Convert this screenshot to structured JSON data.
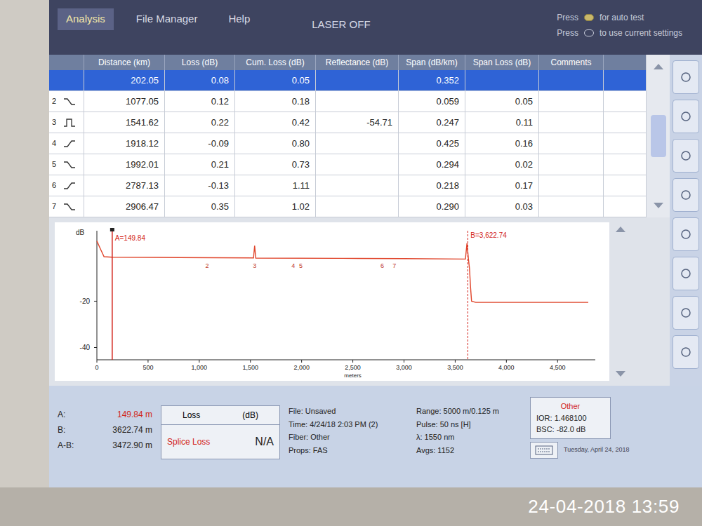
{
  "menu": [
    {
      "label": "Analysis",
      "selected": true
    },
    {
      "label": "File Manager",
      "selected": false
    },
    {
      "label": "Help",
      "selected": false
    }
  ],
  "laser_status": "LASER OFF",
  "press_hints": [
    {
      "before": "Press",
      "after": "for auto test"
    },
    {
      "before": "Press",
      "after": "to use current settings"
    }
  ],
  "table": {
    "columns": [
      "Distance (km)",
      "Loss (dB)",
      "Cum. Loss (dB)",
      "Reflectance (dB)",
      "Span (dB/km)",
      "Span Loss (dB)",
      "Comments"
    ],
    "rows": [
      {
        "index": "",
        "kind": "none",
        "distance": "202.05",
        "loss": "0.08",
        "cum_loss": "0.05",
        "reflectance": "",
        "span": "0.352",
        "span_loss": "",
        "comments": "",
        "selected": true
      },
      {
        "index": "2",
        "kind": "drop",
        "distance": "1077.05",
        "loss": "0.12",
        "cum_loss": "0.18",
        "reflectance": "",
        "span": "0.059",
        "span_loss": "0.05",
        "comments": "",
        "selected": false
      },
      {
        "index": "3",
        "kind": "reflect",
        "distance": "1541.62",
        "loss": "0.22",
        "cum_loss": "0.42",
        "reflectance": "-54.71",
        "span": "0.247",
        "span_loss": "0.11",
        "comments": "",
        "selected": false
      },
      {
        "index": "4",
        "kind": "gain",
        "distance": "1918.12",
        "loss": "-0.09",
        "cum_loss": "0.80",
        "reflectance": "",
        "span": "0.425",
        "span_loss": "0.16",
        "comments": "",
        "selected": false
      },
      {
        "index": "5",
        "kind": "drop",
        "distance": "1992.01",
        "loss": "0.21",
        "cum_loss": "0.73",
        "reflectance": "",
        "span": "0.294",
        "span_loss": "0.02",
        "comments": "",
        "selected": false
      },
      {
        "index": "6",
        "kind": "gain",
        "distance": "2787.13",
        "loss": "-0.13",
        "cum_loss": "1.11",
        "reflectance": "",
        "span": "0.218",
        "span_loss": "0.17",
        "comments": "",
        "selected": false
      },
      {
        "index": "7",
        "kind": "drop",
        "distance": "2906.47",
        "loss": "0.35",
        "cum_loss": "1.02",
        "reflectance": "",
        "span": "0.290",
        "span_loss": "0.03",
        "comments": "",
        "selected": false
      }
    ]
  },
  "chart": {
    "y_label": "dB",
    "y_ticks": [
      {
        "label": "-20",
        "value": -20
      },
      {
        "label": "-40",
        "value": -40
      }
    ],
    "x_ticks": [
      {
        "label": "0",
        "value": 0
      },
      {
        "label": "500",
        "value": 500
      },
      {
        "label": "1,000",
        "value": 1000
      },
      {
        "label": "1,500",
        "value": 1500
      },
      {
        "label": "2,000",
        "value": 2000
      },
      {
        "label": "2,500",
        "value": 2500
      },
      {
        "label": "3,000",
        "value": 3000
      },
      {
        "label": "3,500",
        "value": 3500
      },
      {
        "label": "4,000",
        "value": 4000
      },
      {
        "label": "4,500",
        "value": 4500
      }
    ],
    "x_label": "meters",
    "cursor_a": {
      "label": "A=149.84",
      "position": 149.84
    },
    "cursor_b": {
      "label": "B=3,622.74",
      "position": 3622.74
    },
    "trace": {
      "color": "#e0452b",
      "distances": [
        0,
        30,
        70,
        149.84,
        600,
        1530,
        1541,
        1552,
        2400,
        3000,
        3600,
        3615,
        3630,
        3640,
        3650,
        3660,
        3700,
        4800
      ],
      "values": [
        6,
        3,
        -0.8,
        -1,
        -1.1,
        -1.3,
        4,
        -1.4,
        -1.5,
        -1.6,
        -1.8,
        5,
        -2,
        -6,
        -14,
        -20,
        -20.5,
        -20.5
      ]
    }
  },
  "measurements": [
    {
      "label": "A:",
      "value": "149.84 m"
    },
    {
      "label": "B:",
      "value": "3622.74 m"
    },
    {
      "label": "A-B:",
      "value": "3472.90 m"
    }
  ],
  "loss_box": {
    "title": "Loss",
    "unit": "(dB)",
    "label": "Splice Loss",
    "value": "N/A"
  },
  "file_info": [
    "File: Unsaved",
    "Time: 4/24/18 2:03 PM (2)",
    "Fiber: Other",
    "Props: FAS"
  ],
  "setup_info": [
    "Range: 5000 m/0.125 m",
    "Pulse: 50 ns [H]",
    "λ: 1550 nm",
    "Avgs: 1152"
  ],
  "fiber_info": {
    "title": "Other",
    "lines": [
      "IOR: 1.468100",
      "BSC: -82.0 dB"
    ]
  },
  "status_date": "Tuesday, April 24, 2018",
  "photo_timestamp": "24-04-2018 13:59"
}
